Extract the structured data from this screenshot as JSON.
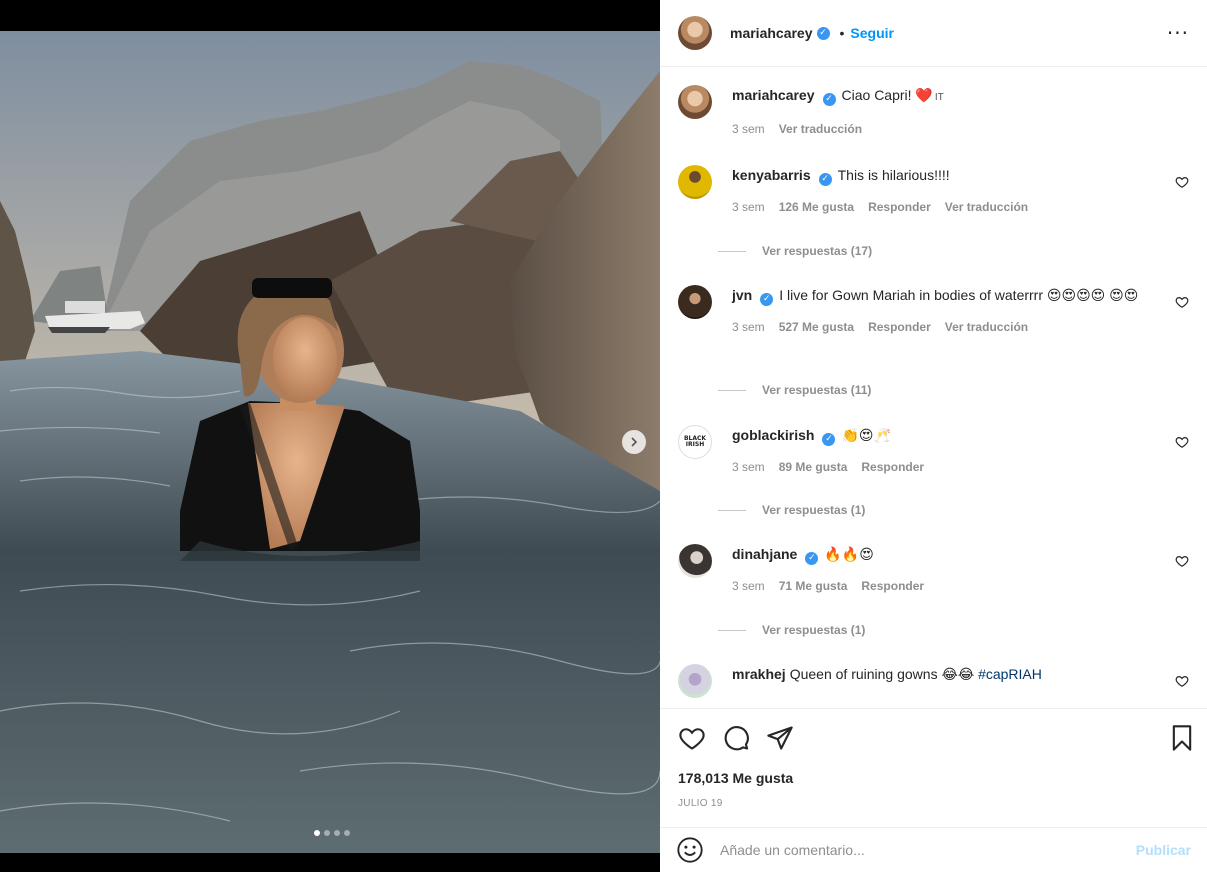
{
  "post": {
    "author": "mariahcarey",
    "follow_label": "Seguir",
    "separator": "•",
    "more_icon": "more-horizontal-icon",
    "caption": {
      "username": "mariahcarey",
      "text": "Ciao Capri! ❤️",
      "flag": "IT",
      "time": "3 sem",
      "translate": "Ver traducción"
    },
    "carousel": {
      "slides": 4,
      "current": 1
    }
  },
  "comments": [
    {
      "username": "kenyabarris",
      "verified": true,
      "text": "This is hilarious!!!!",
      "time": "3 sem",
      "likes": "126 Me gusta",
      "reply": "Responder",
      "translate": "Ver traducción",
      "replies": "Ver respuestas (17)"
    },
    {
      "username": "jvn",
      "verified": true,
      "text": "I live for Gown Mariah in bodies of waterrrr 😍😍😍😍 😍😍",
      "time": "3 sem",
      "likes": "527 Me gusta",
      "reply": "Responder",
      "translate": "Ver traducción",
      "replies": "Ver respuestas (11)"
    },
    {
      "username": "goblackirish",
      "verified": true,
      "text": "👏😍🥂",
      "time": "3 sem",
      "likes": "89 Me gusta",
      "reply": "Responder",
      "replies": "Ver respuestas (1)"
    },
    {
      "username": "dinahjane",
      "verified": true,
      "text": "🔥🔥😍",
      "time": "3 sem",
      "likes": "71 Me gusta",
      "reply": "Responder",
      "replies": "Ver respuestas (1)"
    },
    {
      "username": "mrakhej",
      "verified": false,
      "text": "Queen of ruining gowns 😂😂",
      "hashtag": "#capRIAH"
    }
  ],
  "goblackirish_logo": "BLACK IRISH",
  "actions": {
    "likes": "178,013 Me gusta",
    "date": "JULIO 19"
  },
  "add_comment": {
    "placeholder": "Añade un comentario...",
    "publish": "Publicar"
  },
  "colors": {
    "accent": "#0095f6",
    "verified": "#3897f0",
    "publish_disabled": "#b2dffc"
  }
}
